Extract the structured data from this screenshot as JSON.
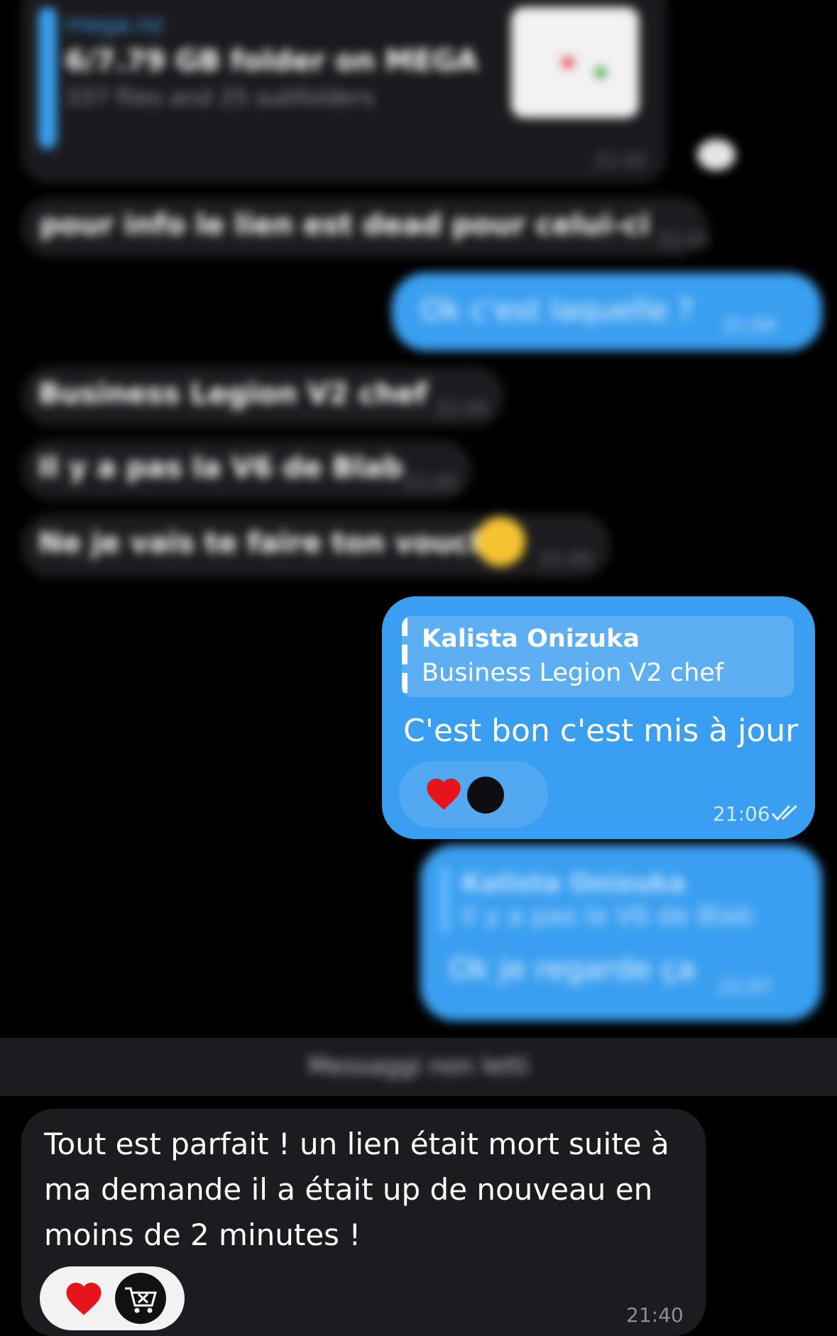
{
  "messages": {
    "forwarded_link": {
      "source": "mega.nz",
      "title": "6/7.79 GB folder on MEGA",
      "subtitle": "337 files and 25 subfolders",
      "time": "21:02"
    },
    "in_1": {
      "text": "pour info le lien est dead pour celui-ci",
      "time": "21:02"
    },
    "out_1": {
      "text": "Ok c'est laquelle ?",
      "time": "21:04"
    },
    "in_2": {
      "text": "Business Legion V2 chef",
      "time": "21:05"
    },
    "in_3": {
      "text": "Il y a pas la V6 de Blab",
      "time": "21:05"
    },
    "in_4": {
      "text": "Ne je vais te faire ton vouch",
      "time": "21:05"
    },
    "reply_1": {
      "quote_name": "Kalista Onizuka",
      "quote_text": "Business Legion V2 chef",
      "text": "C'est bon c'est mis à jour",
      "time": "21:06",
      "reactions": [
        "heart-icon",
        "user-avatar"
      ]
    },
    "reply_2": {
      "quote_name": "Kalista Onizuka",
      "quote_text": "Il y a pas la V6 de Blab",
      "text": "Ok je regarde ça",
      "time": "21:07"
    },
    "unread_label": "Messaggi non letti",
    "final": {
      "text": "Tout est parfait ! un lien était mort suite à ma demande il a était up de nouveau en moins de 2 minutes !",
      "time": "21:40",
      "reactions": [
        "heart-icon",
        "cart-icon"
      ]
    }
  },
  "colors": {
    "outgoing": "#3a9ff0",
    "incoming": "#1c1c1e",
    "background": "#000000"
  }
}
